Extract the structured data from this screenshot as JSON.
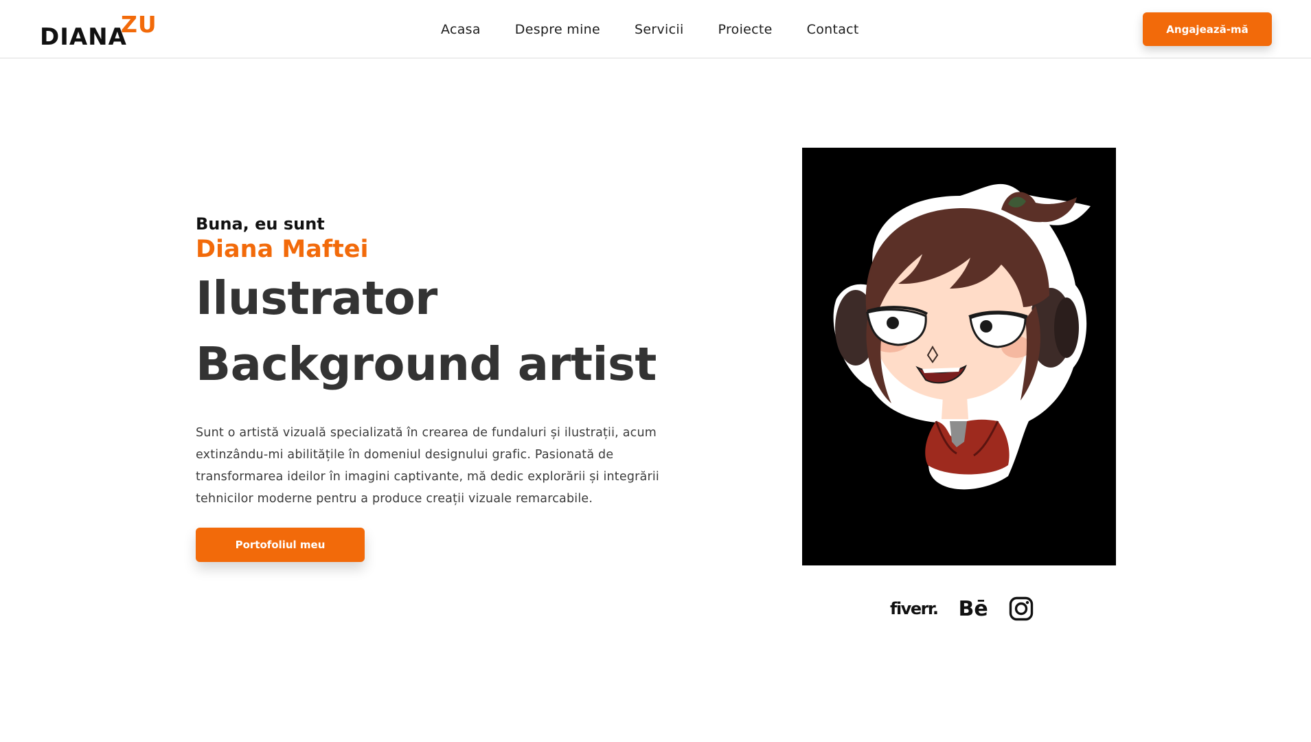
{
  "logo": {
    "main": "DIANA",
    "sup": "ZU"
  },
  "nav": {
    "links": [
      "Acasa",
      "Despre mine",
      "Servicii",
      "Proiecte",
      "Contact"
    ],
    "hire_label": "Angajează-mă"
  },
  "hero": {
    "greeting": "Buna, eu sunt",
    "name": "Diana Maftei",
    "role1": "Ilustrator",
    "role2": "Background artist",
    "description": "Sunt o artistă vizuală specializată în crearea de fundaluri și ilustrații, acum extinzându-mi abilitățile în domeniul designului grafic. Pasionată de transformarea ideilor în imagini captivante, mă dedic explorării și integrării tehnicilor moderne pentru a produce creații vizuale remarcabile.",
    "cta_label": "Portofoliul meu"
  },
  "socials": {
    "fiverr": "fiverr.",
    "behance": "Bē",
    "instagram_icon": "instagram-icon"
  },
  "colors": {
    "accent": "#f26a0a",
    "text": "#333333",
    "portrait_bg": "#000000"
  }
}
